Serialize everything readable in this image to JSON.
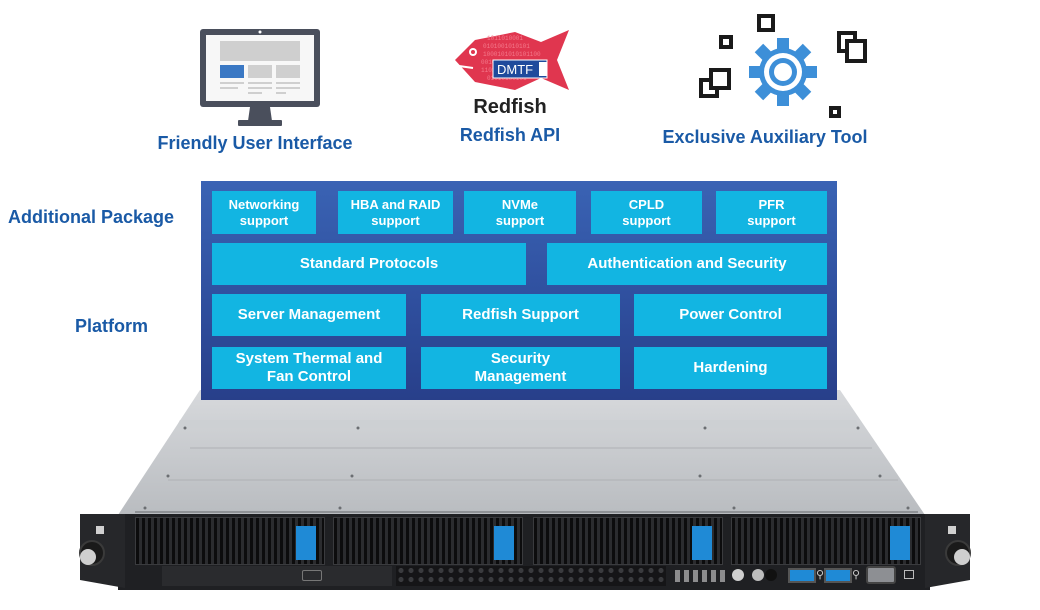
{
  "features": [
    {
      "id": "ui",
      "icon": "monitor-icon",
      "label": "Friendly User Interface"
    },
    {
      "id": "redfish",
      "icon": "redfish-dmtf-logo",
      "logo_text": "DMTF",
      "logo_caption": "Redfish",
      "label": "Redfish API"
    },
    {
      "id": "tool",
      "icon": "gear-icon",
      "label": "Exclusive Auxiliary Tool"
    }
  ],
  "side_labels": {
    "additional": "Additional Package",
    "platform": "Platform"
  },
  "additional_package": [
    "Networking\nsupport",
    "HBA and RAID\nsupport",
    "NVMe\nsupport",
    "CPLD\nsupport",
    "PFR\nsupport"
  ],
  "protocol_row": [
    "Standard Protocols",
    "Authentication and Security"
  ],
  "platform_row1": [
    "Server Management",
    "Redfish Support",
    "Power Control"
  ],
  "platform_row2": [
    "System Thermal and\nFan Control",
    "Security\nManagement",
    "Hardening"
  ],
  "colors": {
    "accent_text": "#1a5aa6",
    "panel": "#2f4f9e",
    "box": "#12b5e2",
    "drive_latch": "#1f8ad6",
    "gear": "#3d8fd8"
  },
  "server": {
    "drive_bays": 4,
    "usb_ports": 2
  }
}
